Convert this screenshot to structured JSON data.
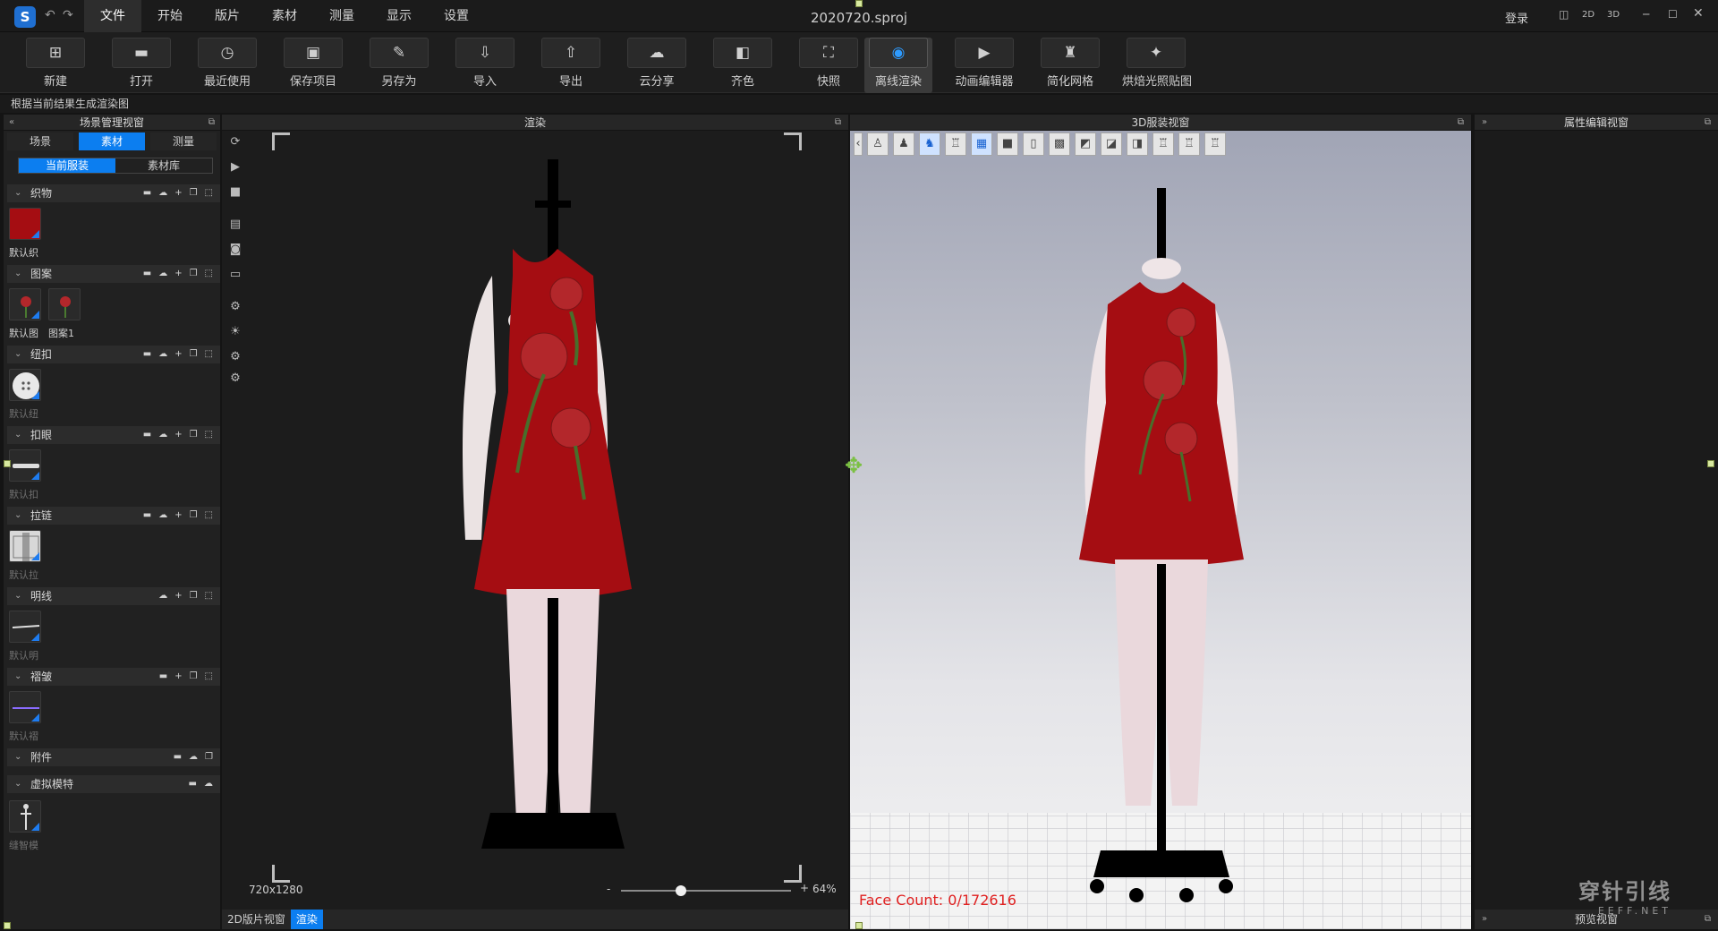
{
  "titlebar": {
    "menu": [
      "文件",
      "开始",
      "版片",
      "素材",
      "测量",
      "显示",
      "设置"
    ],
    "document_title": "2020720.sproj",
    "login": "登录",
    "view_modes": [
      "2D",
      "3D"
    ]
  },
  "toolbar": {
    "buttons": [
      "新建",
      "打开",
      "最近使用",
      "保存项目",
      "另存为",
      "导入",
      "导出",
      "云分享",
      "齐色",
      "快照",
      "离线渲染",
      "动画编辑器",
      "简化网格",
      "烘焙光照贴图"
    ],
    "active": "离线渲染"
  },
  "status_strip": "根据当前结果生成渲染图",
  "scene_panel": {
    "title": "场景管理视窗",
    "tabs": [
      "场景",
      "素材",
      "测量"
    ],
    "active_tab": "素材",
    "subtabs": [
      "当前服装",
      "素材库"
    ],
    "active_subtab": "当前服装",
    "categories": [
      {
        "name": "织物",
        "items": [
          "默认织"
        ]
      },
      {
        "name": "图案",
        "items": [
          "默认图",
          "图案1"
        ]
      },
      {
        "name": "纽扣",
        "items": [
          "默认纽"
        ]
      },
      {
        "name": "扣眼",
        "items": [
          "默认扣"
        ]
      },
      {
        "name": "拉链",
        "items": [
          "默认拉"
        ]
      },
      {
        "name": "明线",
        "items": [
          "默认明"
        ]
      },
      {
        "name": "褶皱",
        "items": [
          "默认褶"
        ]
      },
      {
        "name": "附件",
        "items": []
      },
      {
        "name": "虚拟模特",
        "items": [
          "缝智模"
        ]
      }
    ]
  },
  "render_view": {
    "title": "渲染",
    "resolution": "720x1280",
    "zoom_minus": "-",
    "zoom_plus": "+",
    "zoom": "64%",
    "zoom_level": 0.35
  },
  "view3d": {
    "title": "3D服装视窗",
    "face_count": "Face Count: 0/172616"
  },
  "property_panel": {
    "title": "属性编辑视窗"
  },
  "preview_panel": {
    "title": "预览视窗"
  },
  "bottom_tabs": [
    "2D版片视窗",
    "渲染"
  ],
  "active_bottom_tab": "渲染",
  "watermark": {
    "main": "穿针引线",
    "sub": "EEFF.NET"
  },
  "colors": {
    "accent": "#0c7ef0",
    "dress": "#a50d12",
    "facecount": "#e02020"
  }
}
